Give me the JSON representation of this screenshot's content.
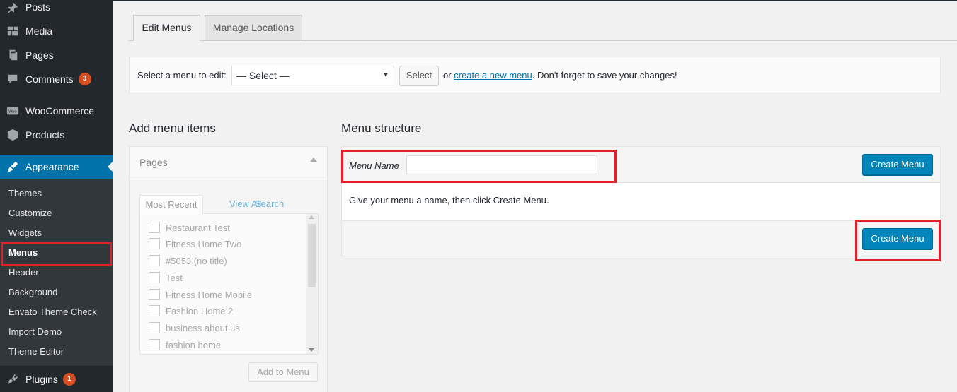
{
  "sidebar": {
    "items": [
      {
        "label": "Posts",
        "icon": "pin-icon"
      },
      {
        "label": "Media",
        "icon": "media-icon"
      },
      {
        "label": "Pages",
        "icon": "pages-icon"
      },
      {
        "label": "Comments",
        "icon": "comments-icon",
        "badge": "3"
      },
      {
        "label": "WooCommerce",
        "icon": "woocommerce-icon"
      },
      {
        "label": "Products",
        "icon": "products-icon"
      },
      {
        "label": "Appearance",
        "icon": "appearance-icon"
      },
      {
        "label": "Plugins",
        "icon": "plugins-icon",
        "badge": "1"
      }
    ],
    "submenu": [
      "Themes",
      "Customize",
      "Widgets",
      "Menus",
      "Header",
      "Background",
      "Envato Theme Check",
      "Import Demo",
      "Theme Editor"
    ],
    "current_submenu": "Menus"
  },
  "tabs": {
    "edit": "Edit Menus",
    "manage": "Manage Locations"
  },
  "select_bar": {
    "label": "Select a menu to edit:",
    "selected": "— Select —",
    "button": "Select",
    "or": "or",
    "link": "create a new menu",
    "after_link": ". Don't forget to save your changes!"
  },
  "add_items": {
    "title": "Add menu items",
    "box_label": "Pages",
    "tabs": [
      "Most Recent",
      "View All",
      "Search"
    ],
    "pages": [
      "Restaurant Test",
      "Fitness Home Two",
      "#5053 (no title)",
      "Test",
      "Fitness Home Mobile",
      "Fashion Home 2",
      "business about us",
      "fashion home"
    ],
    "add_button": "Add to Menu"
  },
  "structure": {
    "title": "Menu structure",
    "name_label": "Menu Name",
    "name_value": "",
    "create_button": "Create Menu",
    "hint": "Give your menu a name, then click Create Menu."
  },
  "colors": {
    "sidebar_bg": "#23282d",
    "submenu_bg": "#32373c",
    "accent": "#0073aa",
    "button_primary": "#0085ba",
    "badge": "#d54e21",
    "highlight": "#e2202a"
  }
}
